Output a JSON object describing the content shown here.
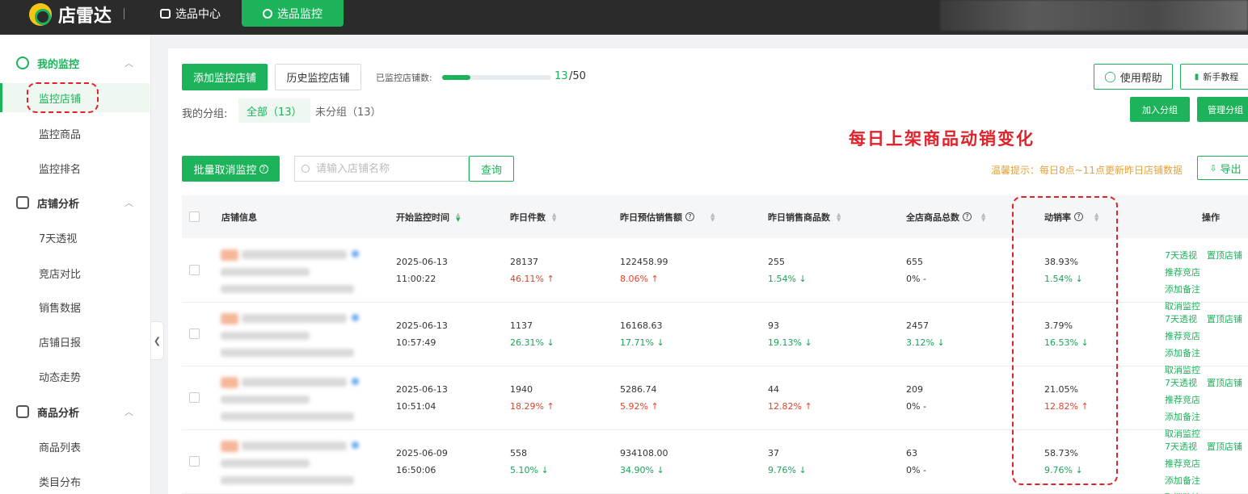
{
  "topbar": {
    "brand": "店雷达",
    "nav": [
      {
        "label": "选品中心"
      },
      {
        "label": "选品监控"
      }
    ]
  },
  "sidebar": {
    "groups": [
      {
        "label": "我的监控",
        "items": [
          "监控店铺",
          "监控商品",
          "监控排名"
        ]
      },
      {
        "label": "店铺分析",
        "items": [
          "7天透视",
          "竞店对比",
          "销售数据",
          "店铺日报",
          "动态走势"
        ]
      },
      {
        "label": "商品分析",
        "items": [
          "商品列表",
          "类目分布"
        ]
      }
    ]
  },
  "toolbar": {
    "add_button": "添加监控店铺",
    "history_button": "历史监控店铺",
    "count_label": "已监控店铺数:",
    "count_current": "13",
    "count_total": "/50",
    "count_fraction": 0.26,
    "help_button": "使用帮助",
    "tutorial_button": "新手教程",
    "group_label": "我的分组:",
    "group_tabs": [
      "全部（13）",
      "未分组（13）"
    ],
    "join_group_button": "加入分组",
    "manage_group_button": "管理分组",
    "annotation": "每日上架商品动销变化",
    "batch_cancel_button": "批量取消监控",
    "search_placeholder": "请输入店铺名称",
    "query_button": "查询",
    "tip": "温馨提示：每日8点~11点更新昨日店铺数据",
    "export_button": "导出"
  },
  "table": {
    "headers": [
      "店铺信息",
      "开始监控时间",
      "昨日件数",
      "昨日预估销售额",
      "昨日销售商品数",
      "全店商品总数",
      "动销率",
      "操作"
    ],
    "ops": [
      "7天透视",
      "置顶店铺",
      "推荐竞店",
      "添加备注",
      "取消监控"
    ],
    "rows": [
      {
        "date": "2025-06-13",
        "time": "11:00:22",
        "qty": "28137",
        "qty_chg": "46.11% ↑",
        "qty_dir": "up",
        "sales": "122458.99",
        "sales_chg": "8.06% ↑",
        "sales_dir": "up",
        "sold": "255",
        "sold_chg": "1.54% ↓",
        "sold_dir": "down",
        "total": "655",
        "total_chg": "0%   -",
        "total_dir": "flat",
        "rate": "38.93%",
        "rate_chg": "1.54% ↓",
        "rate_dir": "down"
      },
      {
        "date": "2025-06-13",
        "time": "10:57:49",
        "qty": "1137",
        "qty_chg": "26.31% ↓",
        "qty_dir": "down",
        "sales": "16168.63",
        "sales_chg": "17.71% ↓",
        "sales_dir": "down",
        "sold": "93",
        "sold_chg": "19.13% ↓",
        "sold_dir": "down",
        "total": "2457",
        "total_chg": "3.12% ↓",
        "total_dir": "down",
        "rate": "3.79%",
        "rate_chg": "16.53% ↓",
        "rate_dir": "down"
      },
      {
        "date": "2025-06-13",
        "time": "10:51:04",
        "qty": "1940",
        "qty_chg": "18.29% ↑",
        "qty_dir": "up",
        "sales": "5286.74",
        "sales_chg": "5.92% ↑",
        "sales_dir": "up",
        "sold": "44",
        "sold_chg": "12.82% ↑",
        "sold_dir": "up",
        "total": "209",
        "total_chg": "0%   -",
        "total_dir": "flat",
        "rate": "21.05%",
        "rate_chg": "12.82% ↑",
        "rate_dir": "up"
      },
      {
        "date": "2025-06-09",
        "time": "16:50:06",
        "qty": "558",
        "qty_chg": "5.10% ↓",
        "qty_dir": "down",
        "sales": "934108.00",
        "sales_chg": "34.90% ↓",
        "sales_dir": "down",
        "sold": "37",
        "sold_chg": "9.76% ↓",
        "sold_dir": "down",
        "total": "63",
        "total_chg": "0%   -",
        "total_dir": "flat",
        "rate": "58.73%",
        "rate_chg": "9.76% ↓",
        "rate_dir": "down"
      }
    ]
  }
}
